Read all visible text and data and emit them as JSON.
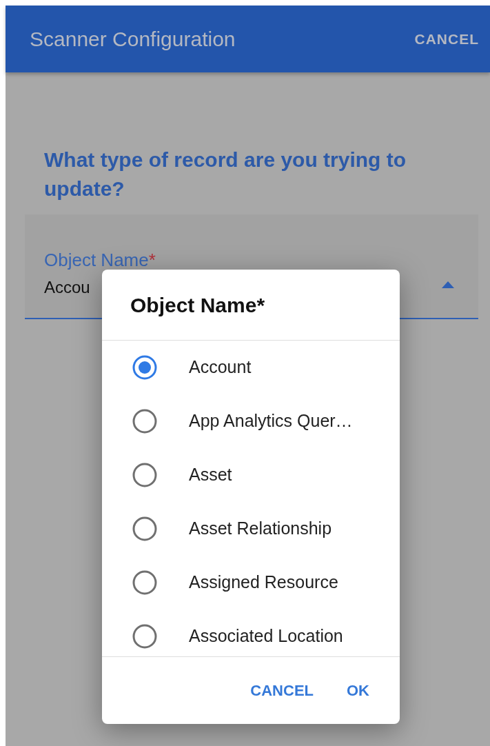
{
  "app_bar": {
    "title": "Scanner Configuration",
    "action": "CANCEL"
  },
  "question": "What type of record are you trying to update?",
  "field": {
    "label": "Object Name",
    "required_mark": "*",
    "value": "Accou"
  },
  "dialog": {
    "title": "Object Name*",
    "options": [
      {
        "label": "Account",
        "selected": true
      },
      {
        "label": "App Analytics Quer…",
        "selected": false
      },
      {
        "label": "Asset",
        "selected": false
      },
      {
        "label": "Asset Relationship",
        "selected": false
      },
      {
        "label": "Assigned Resource",
        "selected": false
      },
      {
        "label": "Associated Location",
        "selected": false
      }
    ],
    "buttons": [
      "CANCEL",
      "OK"
    ]
  }
}
